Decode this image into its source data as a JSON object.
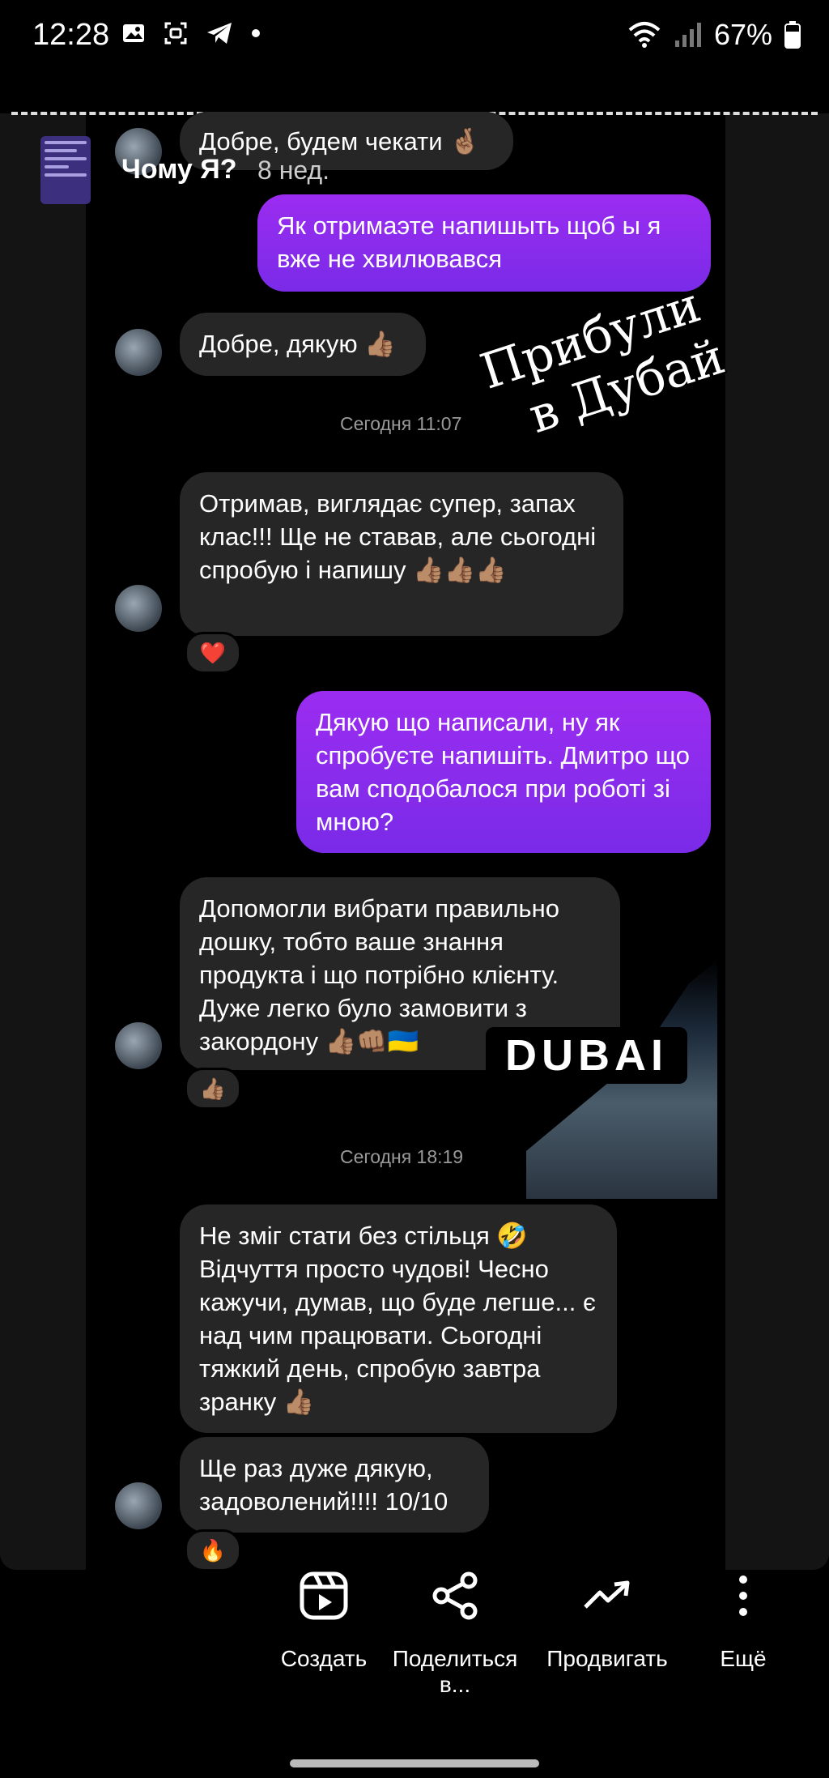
{
  "status": {
    "time": "12:28",
    "battery": "67%"
  },
  "story": {
    "title": "Чому Я?",
    "age": "8 нед."
  },
  "chat": {
    "messages": [
      {
        "dir": "in",
        "text": "Добре, будем чекати 🤞🏽"
      },
      {
        "dir": "out",
        "text": "Як отримаэте напишыть щоб ы я вже не хвилювався"
      },
      {
        "dir": "in",
        "text": "Добре, дякую 👍🏽"
      },
      {
        "dir": "stamp",
        "text": "Сегодня 11:07"
      },
      {
        "dir": "in",
        "text": "Отримав, виглядає супер, запах клас!!! Ще не ставав, але сьогодні спробую і напишу 👍🏽👍🏽👍🏽"
      },
      {
        "dir": "out",
        "text": "Дякую що написали, ну як спробуєте напишіть. Дмитро що вам сподобалося при роботі зі мною?"
      },
      {
        "dir": "in",
        "text": "Допомогли вибрати правильно дошку, тобто ваше знання продукта і що потрібно клієнту. Дуже легко було замовити з закордону 👍🏽👊🏽🇺🇦"
      },
      {
        "dir": "stamp",
        "text": "Сегодня 18:19"
      },
      {
        "dir": "in",
        "text": "Не зміг стати без стільця 🤣 Відчуття просто чудові! Чесно кажучи, думав, що буде легше... є над чим працювати. Сьогодні тяжкий день, спробую завтра зранку 👍🏽"
      },
      {
        "dir": "in",
        "text": "Ще раз дуже дякую, задоволений!!!! 10/10"
      }
    ],
    "reactions": [
      "❤️",
      "👍🏽",
      "🔥"
    ]
  },
  "stickers": {
    "arrived_line1": "Прибули",
    "arrived_line2": "в Дубай",
    "dubai": "DUBAI"
  },
  "actions": [
    {
      "label": "Создать",
      "icon": "reel-play-icon"
    },
    {
      "label": "Поделиться в...",
      "icon": "share-icon"
    },
    {
      "label": "Продвигать",
      "icon": "trend-up-icon"
    },
    {
      "label": "Ещё",
      "icon": "more-vertical-icon"
    }
  ],
  "colors": {
    "incoming_bubble": "#262626",
    "outgoing_bubble": "#8b2cef",
    "background": "#000000"
  }
}
